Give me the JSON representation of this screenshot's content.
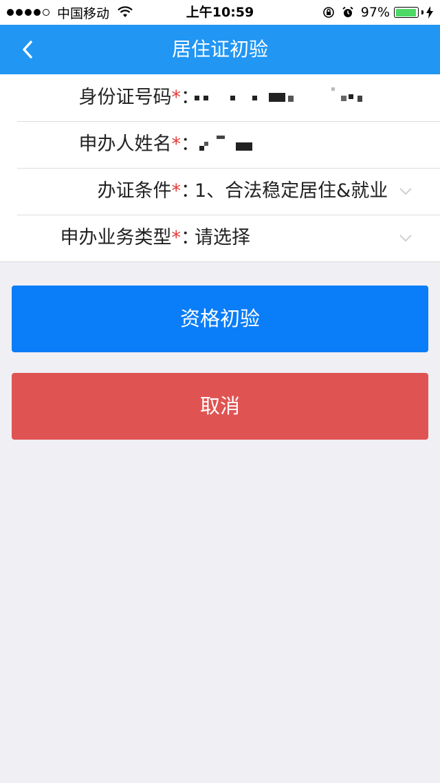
{
  "status_bar": {
    "carrier": "中国移动",
    "time": "上午10:59",
    "battery_percent": "97%",
    "battery_level": 0.97,
    "battery_color": "#4cd964"
  },
  "nav": {
    "title": "居住证初验",
    "back_icon": "chevron-left-icon"
  },
  "form": {
    "fields": [
      {
        "label": "身份证号码",
        "required_mark": "*",
        "colon": "：",
        "value": "",
        "masked": true
      },
      {
        "label": "申办人姓名",
        "required_mark": "*",
        "colon": "：",
        "value": "",
        "masked": true
      },
      {
        "label": "办证条件",
        "required_mark": "*",
        "colon": "：",
        "value": "1、合法稳定居住&就业",
        "dropdown": true
      },
      {
        "label": "申办业务类型",
        "required_mark": "*",
        "colon": "：",
        "value": "请选择",
        "dropdown": true
      }
    ]
  },
  "buttons": {
    "primary_label": "资格初验",
    "cancel_label": "取消"
  },
  "colors": {
    "nav_bg": "#2196f3",
    "primary_button": "#0a7df8",
    "cancel_button": "#df5453",
    "required_mark": "#e53935",
    "page_bg": "#efeff4"
  }
}
